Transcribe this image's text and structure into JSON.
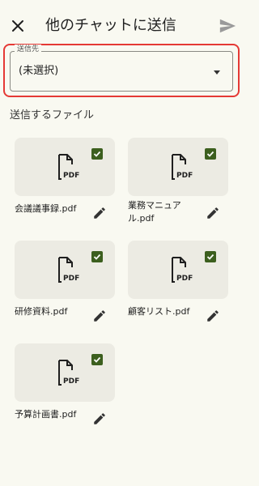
{
  "header": {
    "title": "他のチャットに送信",
    "close_icon": "close-icon",
    "send_icon": "send-icon"
  },
  "destination": {
    "label": "送信先",
    "value": "(未選択)",
    "dropdown_icon": "dropdown-arrow-icon"
  },
  "files_section": {
    "title": "送信するファイル",
    "files": [
      {
        "name": "会議議事録.pdf",
        "checked": true
      },
      {
        "name": "業務マニュアル.pdf",
        "checked": true
      },
      {
        "name": "研修資料.pdf",
        "checked": true
      },
      {
        "name": "顧客リスト.pdf",
        "checked": true
      },
      {
        "name": "予算計画書.pdf",
        "checked": true
      }
    ],
    "thumbnail_icon": "pdf-file-icon",
    "edit_icon": "pencil-icon"
  },
  "colors": {
    "background": "#f9f9f1",
    "checkbox": "#3c5f1e",
    "highlight": "#e53935",
    "thumbnail": "#ecebe3"
  }
}
